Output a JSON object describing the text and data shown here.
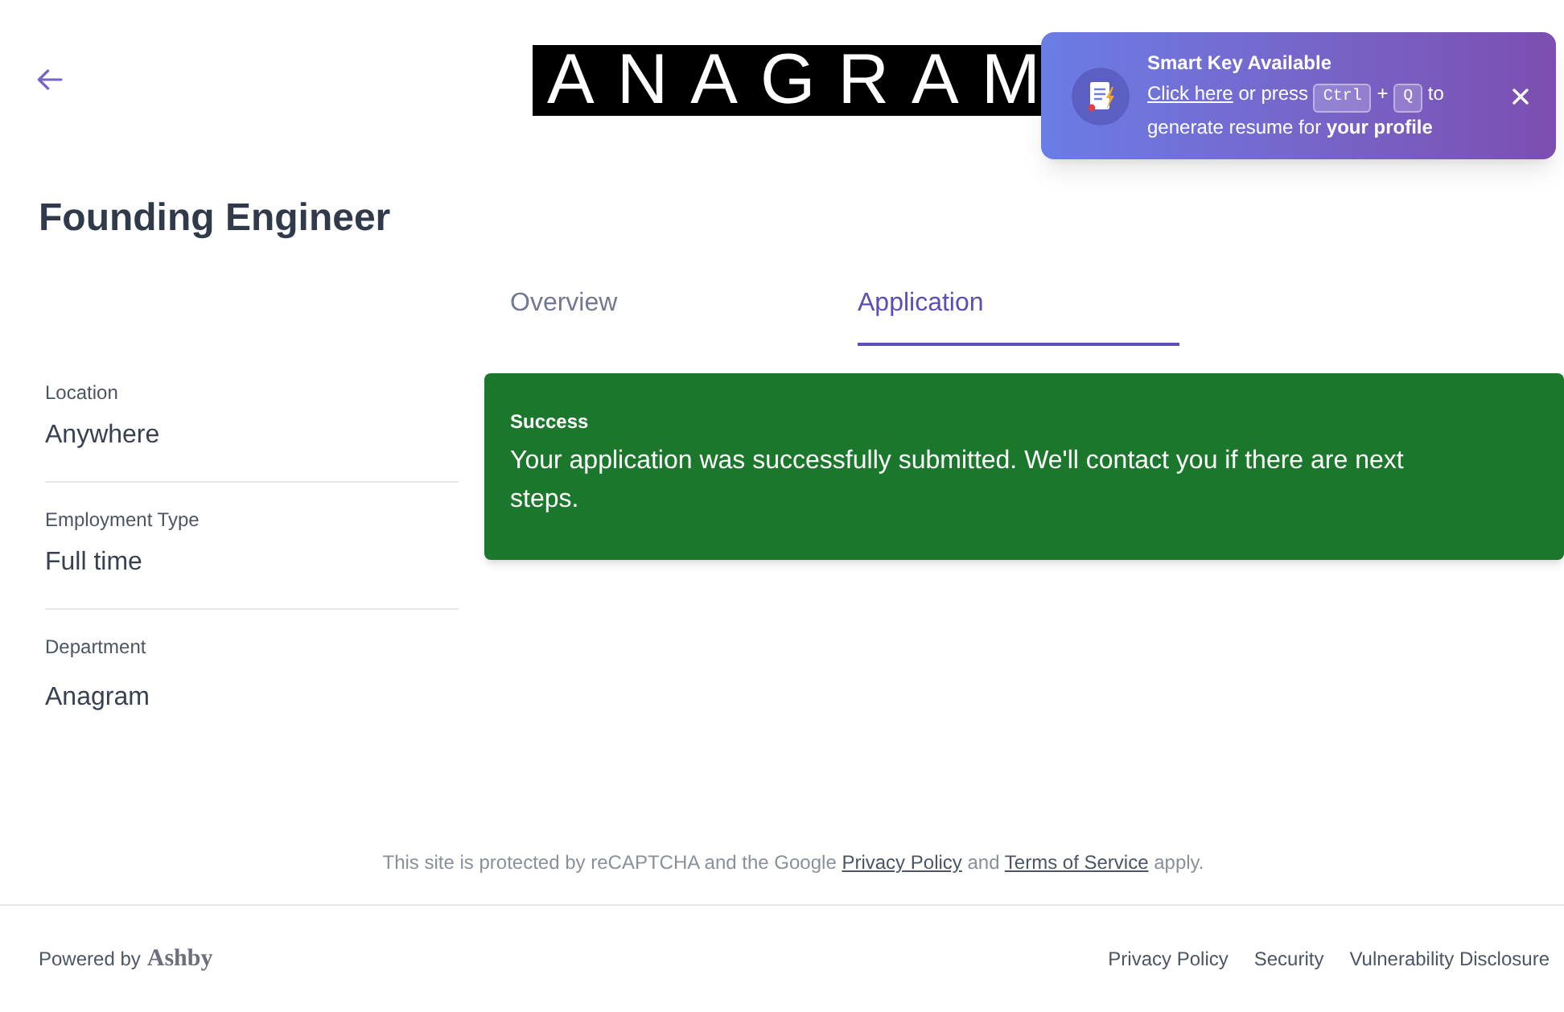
{
  "header": {
    "logo": "ANAGRAM"
  },
  "smart_key_popup": {
    "title": "Smart Key Available",
    "link": "Click here",
    "before_keys": "or press",
    "keys": [
      "Ctrl",
      "Q"
    ],
    "key_joiner": "+",
    "after_keys": "to generate resume for **your profile**"
  },
  "job": {
    "title": "Founding Engineer"
  },
  "tabs": [
    {
      "label": "Overview",
      "selected": false
    },
    {
      "label": "Application",
      "selected": true
    }
  ],
  "details": [
    {
      "label": "Location",
      "value": "Anywhere"
    },
    {
      "label": "Employment Type",
      "value": "Full time"
    },
    {
      "label": "Department",
      "value": "Anagram"
    }
  ],
  "alert": {
    "kind": "success",
    "title": "Success",
    "message": "Your application was successfully submitted. We'll contact you if there are next steps."
  },
  "recaptcha_notice": [
    {
      "kind": "text",
      "text": "This site is protected by reCAPTCHA and the Google"
    },
    {
      "kind": "link",
      "text": "Privacy Policy"
    },
    {
      "kind": "text",
      "text": "and"
    },
    {
      "kind": "link",
      "text": "Terms of Service"
    },
    {
      "kind": "text",
      "text": "apply."
    }
  ],
  "footer": {
    "powered_by": "Powered by",
    "brand": "Ashby",
    "links": [
      "Privacy Policy",
      "Security",
      "Vulnerability Disclosure"
    ]
  }
}
